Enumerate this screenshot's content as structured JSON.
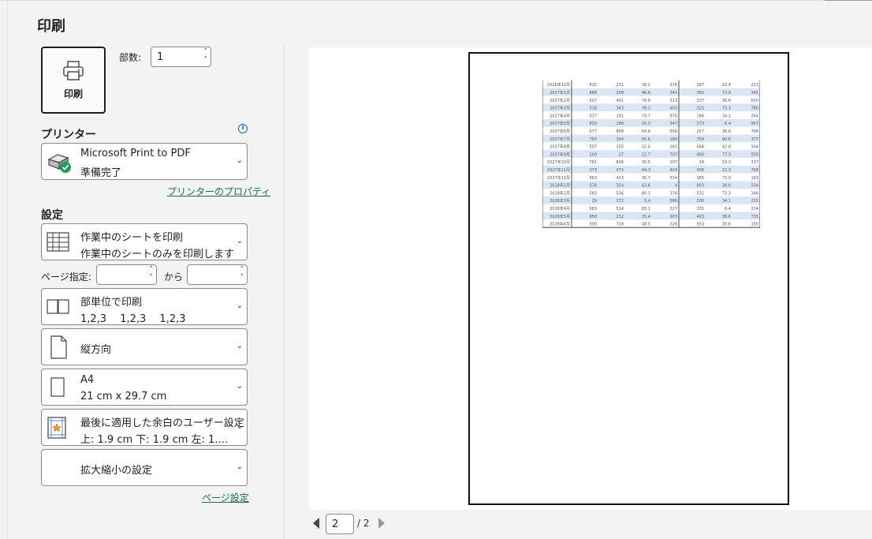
{
  "title": "印刷",
  "print_button": {
    "label": "印刷",
    "icon": "printer-icon"
  },
  "copies": {
    "label": "部数:",
    "value": "1"
  },
  "printer": {
    "heading": "プリンター",
    "name": "Microsoft Print to PDF",
    "status": "準備完了",
    "properties_link": "プリンターのプロパティ"
  },
  "settings": {
    "heading": "設定",
    "scope": {
      "line1": "作業中のシートを印刷",
      "line2": "作業中のシートのみを印刷します"
    },
    "pages": {
      "label": "ページ指定:",
      "from_value": "",
      "to_label": "から",
      "to_value": ""
    },
    "collate": {
      "line1": "部単位で印刷",
      "line2": "1,2,3　 1,2,3　 1,2,3"
    },
    "orientation": {
      "line1": "縦方向"
    },
    "paper": {
      "line1": "A4",
      "line2": "21 cm x 29.7 cm"
    },
    "margins": {
      "line1": "最後に適用した余白のユーザー設定",
      "line2": "上: 1.9 cm 下: 1.9 cm 左: 1.…"
    },
    "scaling": {
      "line1": "拡大縮小の設定"
    },
    "page_setup_link": "ページ設定"
  },
  "preview": {
    "page_current": "2",
    "page_total": "/ 2",
    "table_rows": [
      [
        "2026年12月",
        "415",
        "231",
        "39.2",
        "376",
        "287",
        "23.4",
        "223"
      ],
      [
        "2027年1月",
        "888",
        "208",
        "46.8",
        "342",
        "365",
        "73.9",
        "345"
      ],
      [
        "2027年2月",
        "507",
        "461",
        "78.8",
        "313",
        "337",
        "36.6",
        "650"
      ],
      [
        "2027年3月",
        "518",
        "343",
        "39.2",
        "403",
        "325",
        "73.3",
        "780"
      ],
      [
        "2027年4月",
        "537",
        "101",
        "73.7",
        "875",
        "186",
        "34.1",
        "264"
      ],
      [
        "2027年5月",
        "820",
        "186",
        "16.3",
        "347",
        "273",
        "6.4",
        "957"
      ],
      [
        "2027年6月",
        "677",
        "808",
        "64.6",
        "556",
        "257",
        "38.6",
        "798"
      ],
      [
        "2027年7月",
        "705",
        "354",
        "65.6",
        "184",
        "759",
        "90.6",
        "377"
      ],
      [
        "2027年8月",
        "507",
        "155",
        "32.4",
        "181",
        "668",
        "42.8",
        "304"
      ],
      [
        "2027年9月",
        "200",
        "27",
        "22.7",
        "707",
        "460",
        "77.3",
        "550"
      ],
      [
        "2027年10月",
        "781",
        "806",
        "30.5",
        "107",
        "19",
        "53.3",
        "337"
      ],
      [
        "2027年11月",
        "373",
        "472",
        "44.3",
        "824",
        "008",
        "22.3",
        "768"
      ],
      [
        "2027年12月",
        "863",
        "423",
        "35.7",
        "534",
        "365",
        "73.0",
        "183"
      ],
      [
        "2028年1月",
        "578",
        "354",
        "63.6",
        "4",
        "803",
        "36.6",
        "534"
      ],
      [
        "2028年2月",
        "583",
        "536",
        "80.1",
        "376",
        "531",
        "73.3",
        "346"
      ],
      [
        "2028年3月",
        "29",
        "372",
        "5.4",
        "586",
        "200",
        "34.1",
        "232"
      ],
      [
        "2028年4月",
        "583",
        "524",
        "83.1",
        "327",
        "335",
        "6.4",
        "234"
      ],
      [
        "2028年5月",
        "858",
        "232",
        "35.4",
        "903",
        "403",
        "38.6",
        "735"
      ],
      [
        "2028年6月",
        "500",
        "738",
        "48.5",
        "326",
        "563",
        "30.6",
        "150"
      ]
    ]
  },
  "colors": {
    "accent_link": "#1a6e4b",
    "info": "#1b5fb8",
    "row_alt": "#dce5f4",
    "check": "#1e9e5a"
  }
}
